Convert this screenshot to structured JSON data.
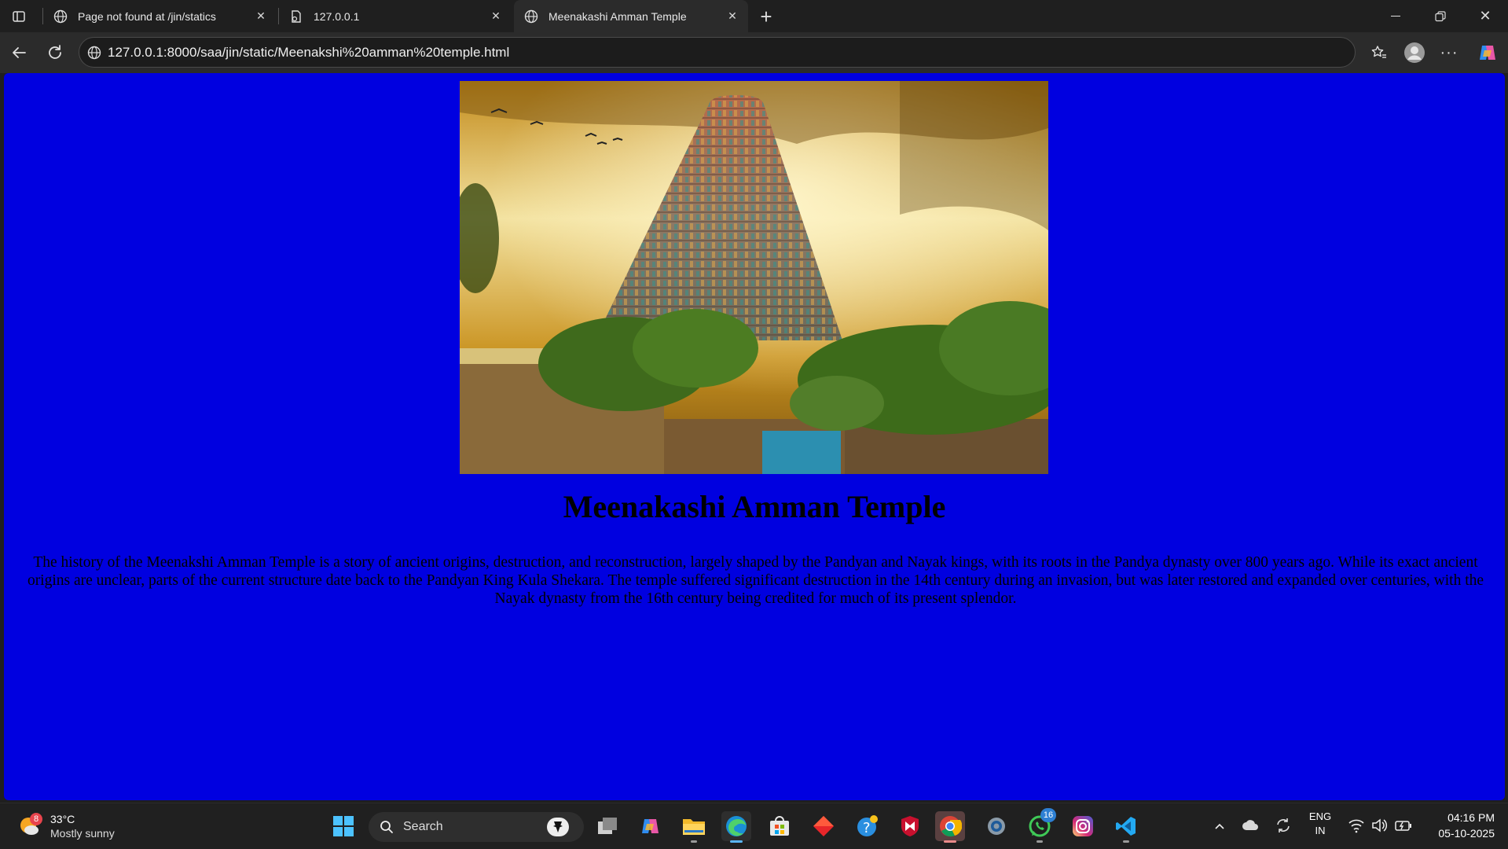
{
  "browser": {
    "tabs": [
      {
        "title": "Page not found at /jin/statics",
        "icon": "globe-icon"
      },
      {
        "title": "127.0.0.1",
        "icon": "document-icon"
      },
      {
        "title": "Meenakashi Amman Temple",
        "icon": "globe-icon",
        "active": true
      }
    ],
    "address_url": "127.0.0.1:8000/saa/jin/static/Meenakshi%20amman%20temple.html"
  },
  "page": {
    "background_color": "#0000e0",
    "image_alt": "Meenakshi Amman Temple gopuram",
    "title": "Meenakashi Amman Temple",
    "paragraph": "The history of the Meenakshi Amman Temple is a story of ancient origins, destruction, and reconstruction, largely shaped by the Pandyan and Nayak kings, with its roots in the Pandya dynasty over 800 years ago. While its exact ancient origins are unclear, parts of the current structure date back to the Pandyan King Kula Shekara. The temple suffered significant destruction in the 14th century during an invasion, but was later restored and expanded over centuries, with the Nayak dynasty from the 16th century being credited for much of its present splendor."
  },
  "taskbar": {
    "weather": {
      "temp": "33°C",
      "condition": "Mostly sunny",
      "badge": "8"
    },
    "search_label": "Search",
    "whatsapp_badge": "16",
    "language": {
      "line1": "ENG",
      "line2": "IN"
    },
    "clock": {
      "time": "04:16 PM",
      "date": "05-10-2025"
    }
  }
}
